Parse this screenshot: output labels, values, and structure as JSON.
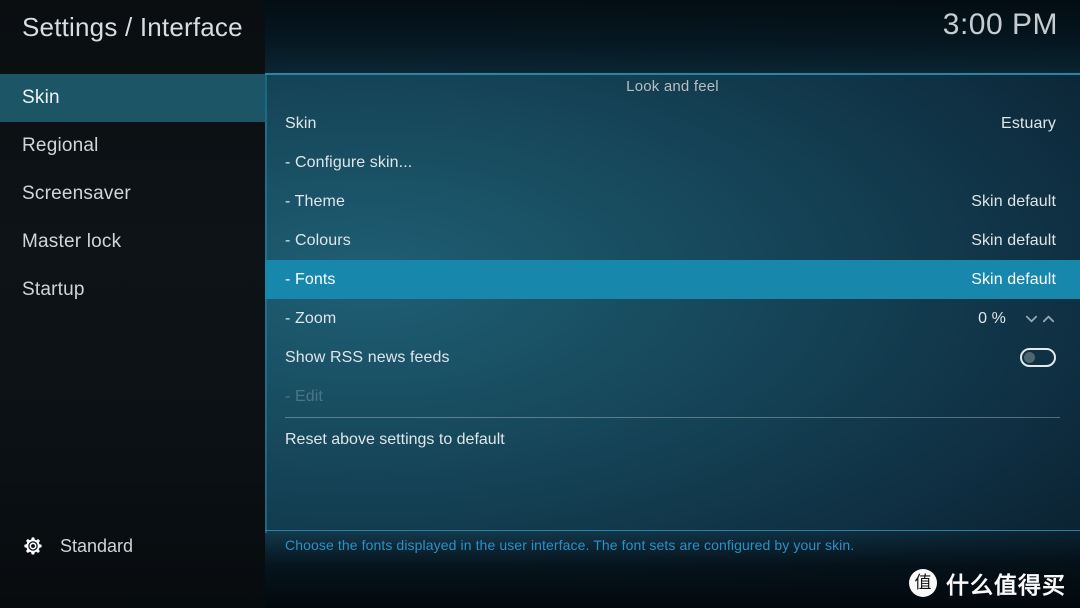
{
  "header": {
    "title": "Settings / Interface",
    "clock": "3:00 PM"
  },
  "sidebar": {
    "items": [
      {
        "label": "Skin",
        "selected": true
      },
      {
        "label": "Regional",
        "selected": false
      },
      {
        "label": "Screensaver",
        "selected": false
      },
      {
        "label": "Master lock",
        "selected": false
      },
      {
        "label": "Startup",
        "selected": false
      }
    ],
    "footer": {
      "icon": "gear-icon",
      "label": "Standard"
    }
  },
  "main": {
    "group_title": "Look and feel",
    "rows": [
      {
        "label": "Skin",
        "value": "Estuary",
        "control": "none",
        "selected": false,
        "disabled": false
      },
      {
        "label": "- Configure skin...",
        "value": "",
        "control": "none",
        "selected": false,
        "disabled": false
      },
      {
        "label": "- Theme",
        "value": "Skin default",
        "control": "none",
        "selected": false,
        "disabled": false
      },
      {
        "label": "- Colours",
        "value": "Skin default",
        "control": "none",
        "selected": false,
        "disabled": false
      },
      {
        "label": "- Fonts",
        "value": "Skin default",
        "control": "none",
        "selected": true,
        "disabled": false
      },
      {
        "label": "- Zoom",
        "value": "0 %",
        "control": "spinner",
        "selected": false,
        "disabled": false
      },
      {
        "label": "Show RSS news feeds",
        "value": "",
        "control": "toggle",
        "toggle_on": false,
        "selected": false,
        "disabled": false
      },
      {
        "label": "- Edit",
        "value": "",
        "control": "none",
        "selected": false,
        "disabled": true
      }
    ],
    "reset_row": {
      "label": "Reset above settings to default"
    },
    "help_text": "Choose the fonts displayed in the user interface. The font sets are configured by your skin."
  },
  "watermark": {
    "badge": "值",
    "text": "什么值得买"
  },
  "colors": {
    "row_highlight": "#1787ab",
    "sidebar_highlight": "#1b5566",
    "accent_line": "#1f89a8",
    "help_text": "#2f8fc4"
  }
}
